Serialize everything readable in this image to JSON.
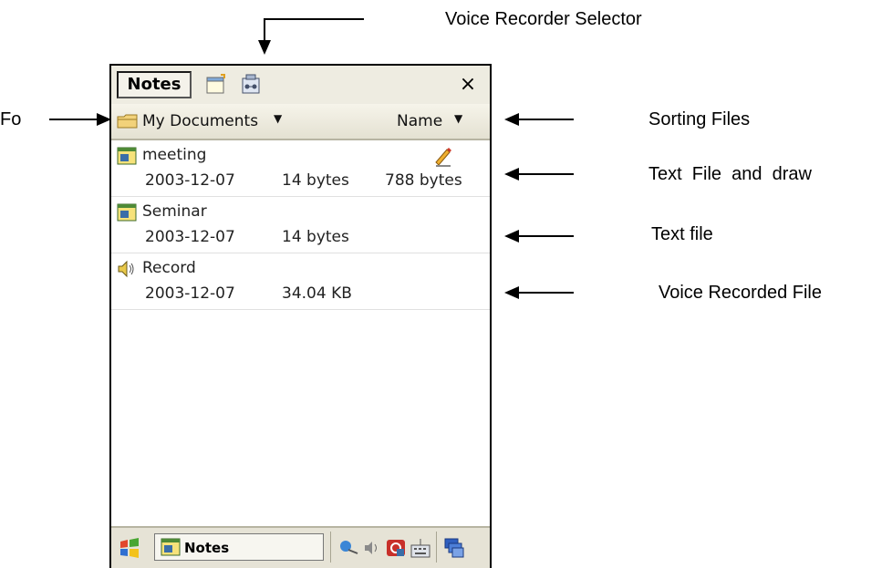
{
  "annotations": {
    "voice_recorder_selector": "Voice Recorder Selector",
    "folder": "Fo",
    "sorting_files": "Sorting Files",
    "text_file_and_draw": "Text  File  and  draw",
    "text_file": "Text file",
    "voice_recorded_file": "Voice Recorded File"
  },
  "toolbar": {
    "title_button": "Notes",
    "close_label": "×",
    "icons": [
      "new-note-icon",
      "voice-recorder-icon"
    ]
  },
  "folder_bar": {
    "folder_label": "My Documents",
    "folder_caret": "▼",
    "sort_label": "Name",
    "sort_caret": "▼"
  },
  "files": [
    {
      "name": "meeting",
      "date": "2003-12-07",
      "size": "14 bytes",
      "extra": "788 bytes",
      "icon": "note-icon",
      "has_drawing": true
    },
    {
      "name": "Seminar",
      "date": "2003-12-07",
      "size": "14 bytes",
      "extra": "",
      "icon": "note-icon",
      "has_drawing": false
    },
    {
      "name": "Record",
      "date": "2003-12-07",
      "size": "34.04 KB",
      "extra": "",
      "icon": "speaker-icon",
      "has_drawing": false
    }
  ],
  "taskbar": {
    "active_task": "Notes",
    "tray_icons": [
      "network-icon",
      "volume-icon",
      "sync-icon",
      "keyboard-icon",
      "windows-icon"
    ]
  }
}
